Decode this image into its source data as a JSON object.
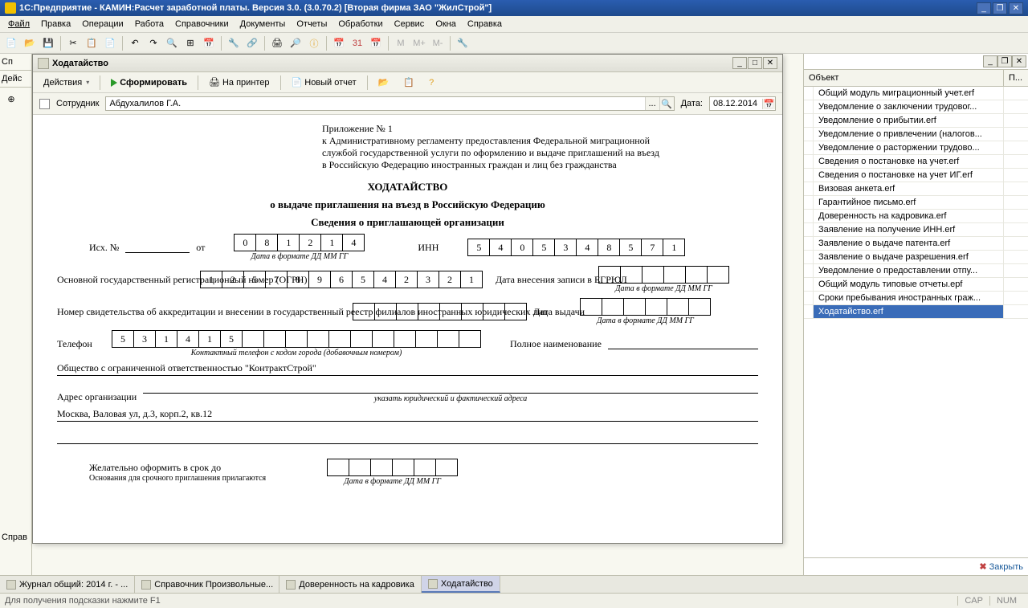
{
  "app": {
    "title": "1С:Предприятие - КАМИН:Расчет заработной платы. Версия 3.0. (3.0.70.2) [Вторая фирма ЗАО \"ЖилСтрой\"]"
  },
  "menu": {
    "file": "Файл",
    "edit": "Правка",
    "operations": "Операции",
    "work": "Работа",
    "refs": "Справочники",
    "docs": "Документы",
    "reports": "Отчеты",
    "processing": "Обработки",
    "service": "Сервис",
    "windows": "Окна",
    "help": "Справка"
  },
  "toolbar_text": {
    "m": "M",
    "m_plus": "M+",
    "m_minus": "M-"
  },
  "left": {
    "actions": "Дейс",
    "left_col": "Сп",
    "refs_lbl": "Справ"
  },
  "window": {
    "title": "Ходатайство",
    "actions": "Действия",
    "form": "Сформировать",
    "print": "На принтер",
    "new_report": "Новый отчет",
    "employee_lbl": "Сотрудник",
    "employee_val": "Абдухалилов Г.А.",
    "date_lbl": "Дата:",
    "date_val": "08.12.2014"
  },
  "doc": {
    "appendix": "Приложение № 1",
    "appendix_l2": "к Административному регламенту предоставления Федеральной миграционной",
    "appendix_l3": "службой государственной услуги по оформлению и выдаче приглашений на въезд",
    "appendix_l4": "в Российскую Федерацию иностранных граждан и лиц без гражданства",
    "title": "ХОДАТАЙСТВО",
    "subtitle": "о выдаче приглашения на въезд в Российскую Федерацию",
    "section": "Сведения о приглашающей организации",
    "out_no": "Исх. №",
    "from": "от",
    "date_cells": [
      "0",
      "8",
      "1",
      "2",
      "1",
      "4"
    ],
    "date_fmt": "Дата в формате ДД ММ ГГ",
    "inn_lbl": "ИНН",
    "inn": [
      "5",
      "4",
      "0",
      "5",
      "3",
      "4",
      "8",
      "5",
      "7",
      "1"
    ],
    "ogrn_lbl": "Основной государственный регистрационный номер (ОГРН)",
    "ogrn": [
      "1",
      "2",
      "5",
      "7",
      "8",
      "9",
      "6",
      "5",
      "4",
      "2",
      "3",
      "2",
      "1"
    ],
    "egrul_lbl": "Дата внесения записи в ЕГРЮЛ",
    "accred_lbl": "Номер свидетельства об аккредитации и внесении в государственный реестр филиалов иностранных юридических лиц",
    "issue_date_lbl": "Дата выдачи",
    "phone_lbl": "Телефон",
    "phone": [
      "5",
      "3",
      "1",
      "4",
      "1",
      "5",
      "",
      "",
      "",
      "",
      "",
      "",
      "",
      "",
      "",
      "",
      ""
    ],
    "phone_hint": "Контактный телефон с кодом города (добавочным номером)",
    "full_name_lbl": "Полное наименование",
    "org_name": "Общество с ограниченной ответственностью \"КонтрактСтрой\"",
    "addr_lbl": "Адрес организации",
    "addr_hint": "указать юридический и фактический адреса",
    "addr_val": "Москва, Валовая ул, д.3, корп.2, кв.12",
    "deadline_lbl": "Желательно оформить в срок до",
    "deadline_hint": "Основания для срочного приглашения прилагаются"
  },
  "right": {
    "col_object": "Объект",
    "col_p": "П...",
    "items": [
      "Общий модуль миграционный учет.erf",
      "Уведомление о заключении трудовог...",
      "Уведомление о прибытии.erf",
      "Уведомление о привлечении (налогов...",
      "Уведомление о расторжении трудово...",
      "Сведения о постановке на учет.erf",
      "Сведения о постановке на учет ИГ.erf",
      "Визовая анкета.erf",
      "Гарантийное письмо.erf",
      "Доверенность на кадровика.erf",
      "Заявление на получение ИНН.erf",
      "Заявление о выдаче патента.erf",
      "Заявление о выдаче разрешения.erf",
      "Уведомление о предоставлении отпу...",
      "Общий модуль типовые отчеты.epf",
      "Сроки пребывания иностранных граж...",
      "Ходатайство.erf"
    ],
    "close": "Закрыть"
  },
  "tasks": [
    "Журнал общий: 2014 г. - ...",
    "Справочник Произвольные...",
    "Доверенность на кадровика",
    "Ходатайство"
  ],
  "status": {
    "hint": "Для получения подсказки нажмите F1",
    "cap": "CAP",
    "num": "NUM"
  }
}
